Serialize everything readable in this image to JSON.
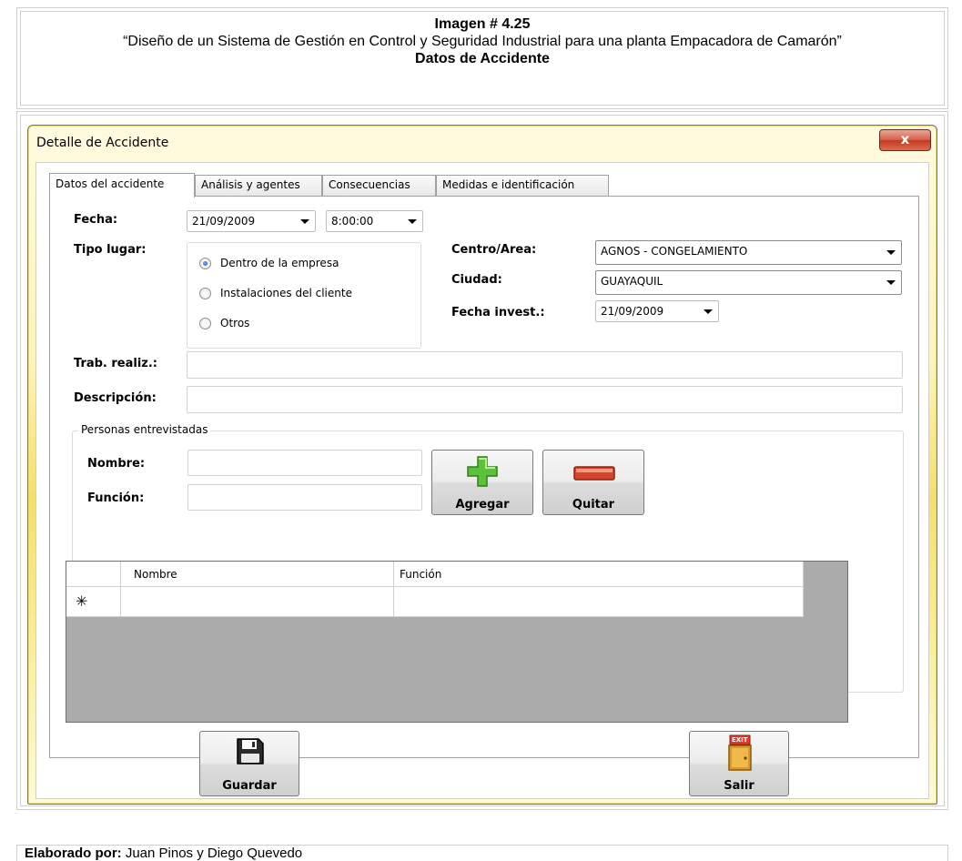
{
  "document": {
    "figure_number": "Imagen # 4.25",
    "subtitle": "“Diseño de un Sistema de Gestión en Control y Seguridad Industrial para una planta Empacadora de Camarón”",
    "caption": "Datos de Accidente",
    "footer_label": "Elaborado por:",
    "footer_value": " Juan Pinos y Diego Quevedo"
  },
  "window": {
    "title": "Detalle de Accidente",
    "close_label": "x"
  },
  "tabs": [
    {
      "label": "Datos del accidente"
    },
    {
      "label": "Análisis y agentes"
    },
    {
      "label": "Consecuencias"
    },
    {
      "label": "Medidas e identificación"
    }
  ],
  "form": {
    "fecha_label": "Fecha:",
    "fecha_value": "21/09/2009",
    "hora_value": "8:00:00",
    "tipo_lugar_label": "Tipo lugar:",
    "tipo_lugar_options": [
      "Dentro de la empresa",
      "Instalaciones del cliente",
      "Otros"
    ],
    "tipo_lugar_selected": "Dentro de la empresa",
    "centro_label": "Centro/Area:",
    "centro_value": "AGNOS - CONGELAMIENTO",
    "ciudad_label": "Ciudad:",
    "ciudad_value": "GUAYAQUIL",
    "fecha_invest_label": "Fecha invest.:",
    "fecha_invest_value": "21/09/2009",
    "trab_label": "Trab. realiz.:",
    "trab_value": "",
    "descripcion_label": "Descripción:",
    "descripcion_value": ""
  },
  "personas": {
    "group_title": "Personas entrevistadas",
    "nombre_label": "Nombre:",
    "funcion_label": "Función:",
    "agregar_label": "Agregar",
    "quitar_label": "Quitar",
    "grid_columns": [
      "Nombre",
      "Función"
    ],
    "new_row_marker": "✳"
  },
  "actions": {
    "guardar_label": "Guardar",
    "salir_label": "Salir",
    "exit_sign": "EXIT"
  },
  "colors": {
    "window_accent": "#f3e06a",
    "add_icon": "#5cc23a",
    "remove_icon": "#d8432b"
  }
}
